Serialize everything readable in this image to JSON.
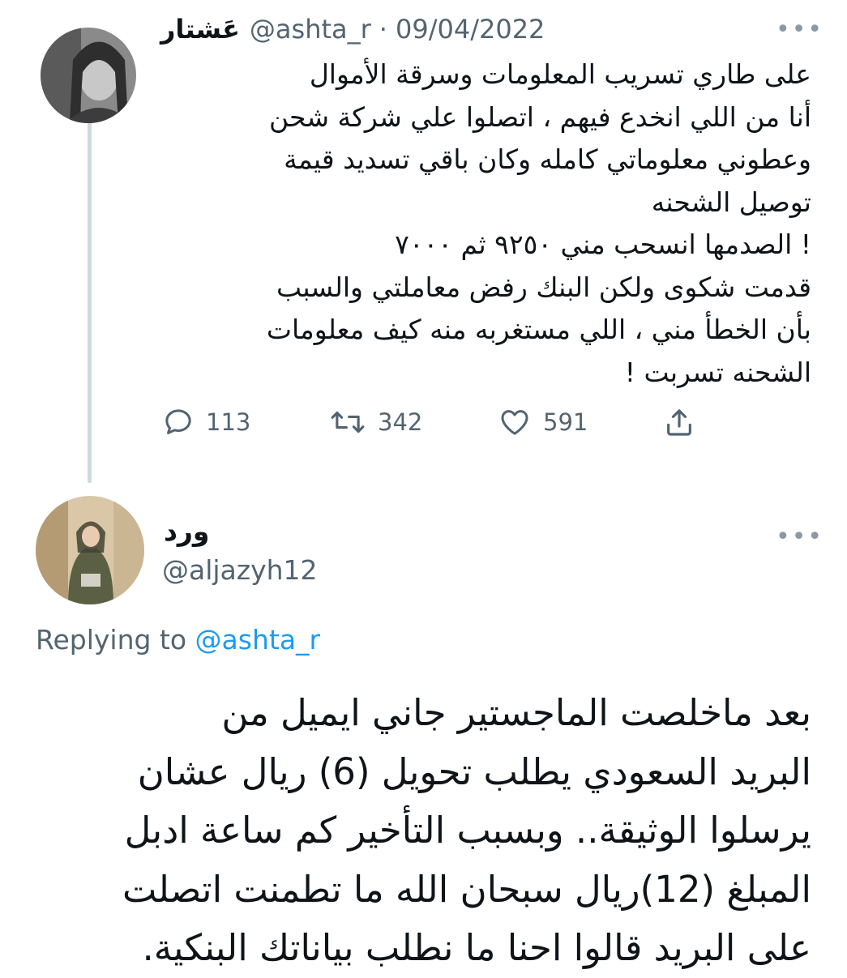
{
  "tweet": {
    "author_name": "عَشتار",
    "author_handle": "@ashta_r",
    "separator": "·",
    "date": "09/04/2022",
    "more_label": "•••",
    "text": "على طاري تسريب المعلومات وسرقة الأموال\nأنا من اللي انخدع فيهم ، اتصلوا علي شركة شحن\nوعطوني معلوماتي كامله وكان باقي تسديد قيمة\nتوصيل الشحنه\n! الصدمها انسحب مني ٩٢٥٠ ثم ٧٠٠٠\nقدمت شكوى ولكن البنك رفض معاملتي والسبب\nبأن الخطأ مني ، اللي مستغربه منه كيف معلومات\nالشحنه تسربت !",
    "actions": {
      "reply_count": "113",
      "retweet_count": "342",
      "like_count": "591"
    },
    "icons": [
      "reply-icon",
      "retweet-icon",
      "like-icon",
      "share-icon",
      "more-icon"
    ]
  },
  "reply": {
    "author_name": "ورد",
    "author_handle": "@aljazyh12",
    "more_label": "•••",
    "replying_prefix": "Replying to",
    "replying_handle": "@ashta_r",
    "text": "بعد ماخلصت الماجستير جاني ايميل من\nالبريد السعودي يطلب تحويل (6) ريال عشان\nيرسلوا الوثيقة.. وبسبب التأخير كم ساعة ادبل\nالمبلغ (12)ريال سبحان الله ما تطمنت اتصلت\nعلى البريد قالوا احنا ما نطلب بياناتك البنكية."
  },
  "colors": {
    "text": "#0f1419",
    "secondary": "#536471",
    "link": "#1d9bf0",
    "thread_line": "#cfd9de"
  }
}
